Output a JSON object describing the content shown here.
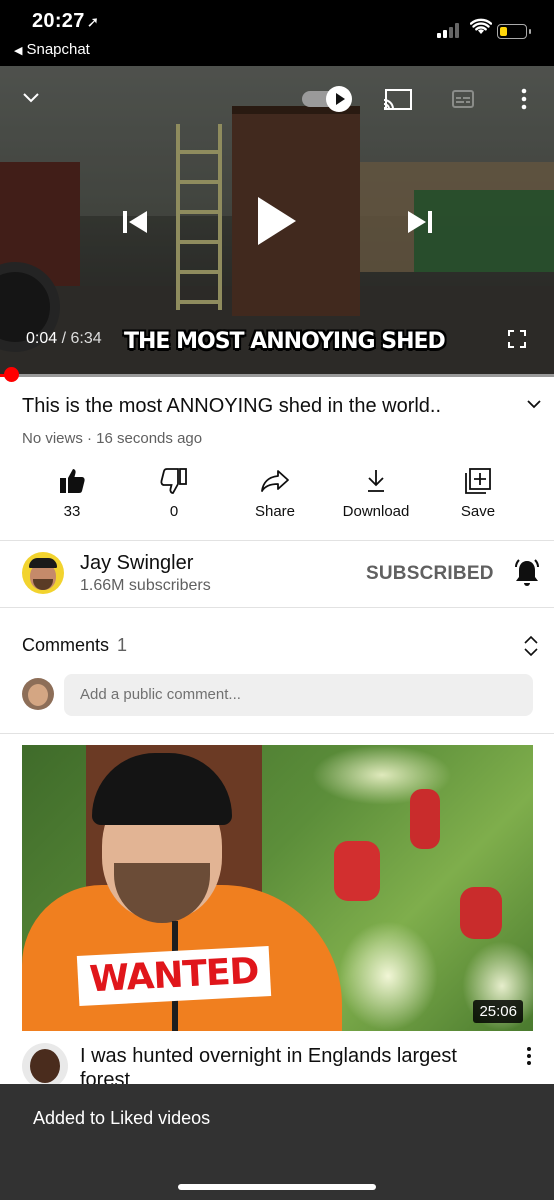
{
  "status_bar": {
    "time": "20:27",
    "back_label": "Snapchat",
    "battery_level": 0.3,
    "battery_color": "#ffd60a"
  },
  "player": {
    "current_time": "0:04",
    "duration": "6:34",
    "overlay_title": "THE MOST ANNOYING SHED",
    "progress_fraction": 0.01,
    "autoplay_on": true,
    "icons": [
      "chevron-down-icon",
      "autoplay-toggle",
      "cast-icon",
      "captions-icon",
      "more-vert-icon",
      "previous-icon",
      "play-icon",
      "next-icon",
      "fullscreen-icon"
    ]
  },
  "video": {
    "title": "This is the most ANNOYING shed in the world..",
    "meta": "No views · 16 seconds ago"
  },
  "actions": [
    {
      "label": "33",
      "icon": "thumbs-up-filled-icon"
    },
    {
      "label": "0",
      "icon": "thumbs-down-icon"
    },
    {
      "label": "Share",
      "icon": "share-icon"
    },
    {
      "label": "Download",
      "icon": "download-icon"
    },
    {
      "label": "Save",
      "icon": "save-playlist-icon"
    }
  ],
  "channel": {
    "name": "Jay Swingler",
    "subscribers": "1.66M subscribers",
    "subscribe_label": "SUBSCRIBED"
  },
  "comments": {
    "label": "Comments",
    "count": "1",
    "placeholder": "Add a public comment..."
  },
  "recommended": {
    "thumbnail_text": "WANTED",
    "duration": "25:06",
    "title": "I was hunted overnight in Englands largest forest"
  },
  "snackbar": {
    "message": "Added to Liked videos"
  },
  "colors": {
    "accent_red": "#ff0000",
    "secondary_text": "#606060",
    "snackbar_bg": "#323232"
  }
}
